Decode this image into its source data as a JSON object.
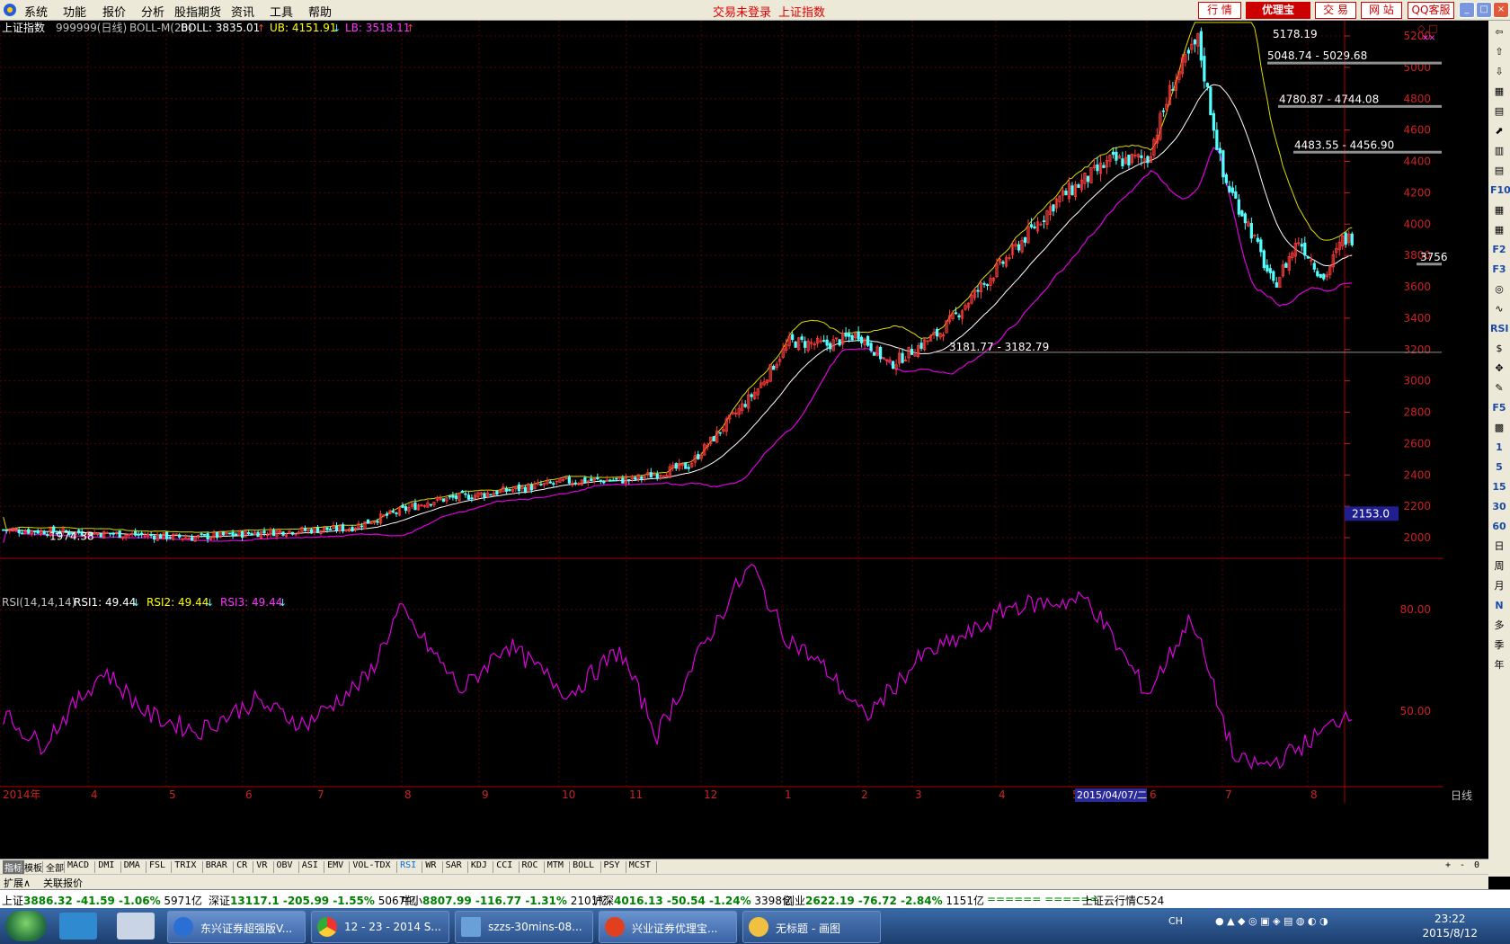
{
  "menu": {
    "items": [
      "系统",
      "功能",
      "报价",
      "分析",
      "股指期货",
      "资讯",
      "工具",
      "帮助"
    ],
    "center_status": [
      "交易未登录",
      "上证指数"
    ],
    "right_buttons": [
      "行 情",
      "优理宝",
      "交 易",
      "网 站",
      "QQ客服"
    ],
    "window_controls": [
      "_",
      "□",
      "×"
    ]
  },
  "colors": {
    "background": "#000000",
    "grid": "#550000",
    "axis_label": "#cc2222",
    "up_candle": "#ff3b3b",
    "down_candle": "#54ffff",
    "mid_band": "#ffffff",
    "upper_band": "#dddd00",
    "lower_band": "#dd00dd",
    "rsi_line": "#dd00dd"
  },
  "main_chart": {
    "header": {
      "name": "上证指数",
      "code_period": "999999(日线)",
      "indicator": "BOLL-M(20)",
      "boll": "BOLL: 3835.01",
      "ub": "UB: 4151.91",
      "lb": "LB: 3518.11"
    },
    "price_ticks": [
      "5200",
      "5000",
      "4800",
      "4600",
      "4400",
      "4200",
      "4000",
      "3800",
      "3600",
      "3400",
      "3200",
      "3000",
      "2800",
      "2600",
      "2400",
      "2200",
      "2000"
    ],
    "current_price_label": "2153.0",
    "annotations": [
      {
        "text": "5178.19",
        "price": 5178
      },
      {
        "text": "5048.74 - 5029.68",
        "price": 5039
      },
      {
        "text": "4780.87 - 4744.08",
        "price": 4762
      },
      {
        "text": "4483.55 - 4456.90",
        "price": 4470
      },
      {
        "text": "3181.77 - 3182.79",
        "price": 3182
      },
      {
        "text": "3756",
        "price": 3756
      },
      {
        "text": "1974.38",
        "price": 1974
      }
    ]
  },
  "rsi_chart": {
    "header": {
      "name": "RSI(14,14,14)",
      "rsi1": "RSI1: 49.44",
      "rsi2": "RSI2: 49.44",
      "rsi3": "RSI3: 49.44"
    },
    "ticks": [
      "80.00",
      "50.00"
    ]
  },
  "chart_data": {
    "type": "candlestick",
    "title": "上证指数",
    "ylim": [
      1900,
      5260
    ],
    "x_tick_labels": [
      "2014年",
      "4",
      "5",
      "6",
      "7",
      "8",
      "9",
      "10",
      "11",
      "12",
      "1",
      "2",
      "3",
      "4",
      "5",
      "6",
      "7",
      "8"
    ],
    "hover_date": "2015/04/07/二",
    "period_label": "日线",
    "price_path_keypoints": [
      {
        "i": 0,
        "close": 2050
      },
      {
        "i": 40,
        "close": 2020
      },
      {
        "i": 60,
        "close": 2000
      },
      {
        "i": 80,
        "close": 2030
      },
      {
        "i": 110,
        "close": 2060
      },
      {
        "i": 135,
        "close": 2230
      },
      {
        "i": 160,
        "close": 2300
      },
      {
        "i": 180,
        "close": 2360
      },
      {
        "i": 200,
        "close": 2370
      },
      {
        "i": 218,
        "close": 2460
      },
      {
        "i": 240,
        "close": 2950
      },
      {
        "i": 250,
        "close": 3250
      },
      {
        "i": 262,
        "close": 3230
      },
      {
        "i": 272,
        "close": 3300
      },
      {
        "i": 282,
        "close": 3100
      },
      {
        "i": 298,
        "close": 3310
      },
      {
        "i": 320,
        "close": 3800
      },
      {
        "i": 335,
        "close": 4150
      },
      {
        "i": 352,
        "close": 4400
      },
      {
        "i": 364,
        "close": 4420
      },
      {
        "i": 372,
        "close": 4900
      },
      {
        "i": 380,
        "close": 5170
      },
      {
        "i": 388,
        "close": 4300
      },
      {
        "i": 396,
        "close": 4000
      },
      {
        "i": 404,
        "close": 3600
      },
      {
        "i": 412,
        "close": 3900
      },
      {
        "i": 420,
        "close": 3650
      },
      {
        "i": 426,
        "close": 3900
      }
    ],
    "rsi_keypoints": [
      {
        "i": 0,
        "rsi": 49
      },
      {
        "i": 12,
        "rsi": 40
      },
      {
        "i": 32,
        "rsi": 62
      },
      {
        "i": 46,
        "rsi": 49
      },
      {
        "i": 62,
        "rsi": 44
      },
      {
        "i": 80,
        "rsi": 53
      },
      {
        "i": 96,
        "rsi": 46
      },
      {
        "i": 116,
        "rsi": 60
      },
      {
        "i": 126,
        "rsi": 80
      },
      {
        "i": 146,
        "rsi": 56
      },
      {
        "i": 160,
        "rsi": 70
      },
      {
        "i": 180,
        "rsi": 55
      },
      {
        "i": 196,
        "rsi": 68
      },
      {
        "i": 208,
        "rsi": 43
      },
      {
        "i": 222,
        "rsi": 68
      },
      {
        "i": 232,
        "rsi": 85
      },
      {
        "i": 238,
        "rsi": 93
      },
      {
        "i": 248,
        "rsi": 73
      },
      {
        "i": 262,
        "rsi": 62
      },
      {
        "i": 274,
        "rsi": 48
      },
      {
        "i": 292,
        "rsi": 66
      },
      {
        "i": 310,
        "rsi": 74
      },
      {
        "i": 320,
        "rsi": 81
      },
      {
        "i": 345,
        "rsi": 83
      },
      {
        "i": 364,
        "rsi": 55
      },
      {
        "i": 378,
        "rsi": 78
      },
      {
        "i": 392,
        "rsi": 35
      },
      {
        "i": 402,
        "rsi": 34
      },
      {
        "i": 410,
        "rsi": 38
      },
      {
        "i": 420,
        "rsi": 44
      },
      {
        "i": 428,
        "rsi": 50
      }
    ]
  },
  "indicator_tabs": [
    "指标",
    "模板",
    "全部",
    "MACD",
    "DMI",
    "DMA",
    "FSL",
    "TRIX",
    "BRAR",
    "CR",
    "VR",
    "OBV",
    "ASI",
    "EMV",
    "VOL-TDX",
    "RSI",
    "WR",
    "SAR",
    "KDJ",
    "CCI",
    "ROC",
    "MTM",
    "BOLL",
    "PSY",
    "MCST"
  ],
  "indicator_tab_right": [
    "+",
    "-",
    "0"
  ],
  "ext_bar": [
    "扩展∧",
    "关联报价"
  ],
  "right_toolbar": [
    "⇦",
    "⇧",
    "⇩",
    "▦",
    "▤",
    "⬈",
    "▥",
    "▤",
    "F10",
    "▦",
    "▦",
    "F2",
    "F3",
    "◎",
    "∿",
    "RSI",
    "$",
    "✥",
    "✎",
    "F5",
    "▩",
    "1",
    "5",
    "15",
    "30",
    "60",
    "日",
    "周",
    "月",
    "N",
    "多",
    "季",
    "年"
  ],
  "ticker": [
    {
      "name": "上证",
      "price": "3886.32",
      "chg": "-41.59",
      "pct": "-1.06%",
      "amount": "5971亿"
    },
    {
      "name": "深证",
      "price": "13117.1",
      "chg": "-205.99",
      "pct": "-1.55%",
      "amount": "5067亿"
    },
    {
      "name": "中小",
      "price": "8807.99",
      "chg": "-116.77",
      "pct": "-1.31%",
      "amount": "2101亿"
    },
    {
      "name": "沪深",
      "price": "4016.13",
      "chg": "-50.54",
      "pct": "-1.24%",
      "amount": "3398亿"
    },
    {
      "name": "创业",
      "price": "2622.19",
      "chg": "-76.72",
      "pct": "-2.84%",
      "amount": "1151亿"
    }
  ],
  "ticker_extra": {
    "bars": "====== ======",
    "cloud": "上证云行情C524"
  },
  "taskbar": {
    "tasks": [
      "东兴证券超强版V...",
      "12 - 23 - 2014 S...",
      "szzs-30mins-08...",
      "兴业证券优理宝...",
      "无标题 - 画图"
    ],
    "lang": "CH",
    "time": "23:22",
    "date": "2015/8/12"
  }
}
